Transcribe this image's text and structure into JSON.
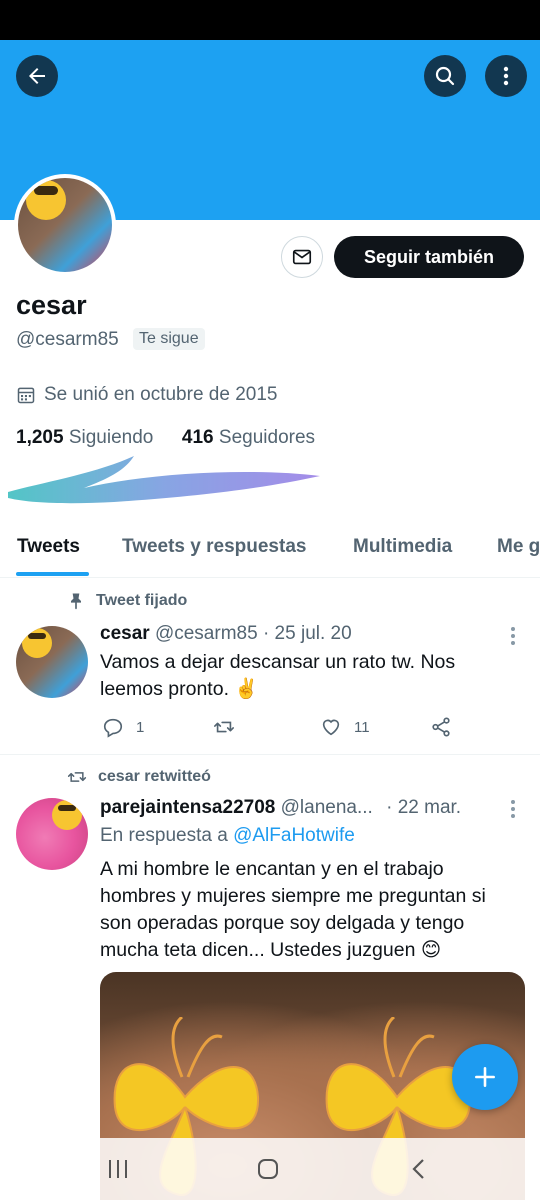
{
  "profile": {
    "name": "cesar",
    "handle": "@cesarm85",
    "follows_you": "Te sigue",
    "joined": "Se unió en octubre de 2015",
    "following_count": "1,205",
    "following_label": "Siguiendo",
    "followers_count": "416",
    "followers_label": "Seguidores",
    "follow_button": "Seguir también"
  },
  "tabs": [
    "Tweets",
    "Tweets y respuestas",
    "Multimedia",
    "Me g"
  ],
  "tweets": [
    {
      "context": "Tweet fijado",
      "name": "cesar",
      "handle": "@cesarm85",
      "date": "· 25 jul. 20",
      "text": "Vamos a dejar descansar un rato tw. Nos leemos pronto. ✌️",
      "replies": "1",
      "likes": "11"
    },
    {
      "context": "cesar retwitteó",
      "name": "parejaintensa22708",
      "handle": "@lanena...",
      "date": "· 22 mar.",
      "reply_prefix": "En respuesta a",
      "reply_to": "@AlFaHotwife",
      "text": "A mi hombre le encantan y en el trabajo hombres y mujeres siempre me preguntan si son operadas porque soy delgada y tengo mucha teta dicen... Ustedes juzguen 😊"
    }
  ],
  "colors": {
    "accent": "#1da1f2",
    "text": "#0f1419",
    "muted": "#536471"
  }
}
